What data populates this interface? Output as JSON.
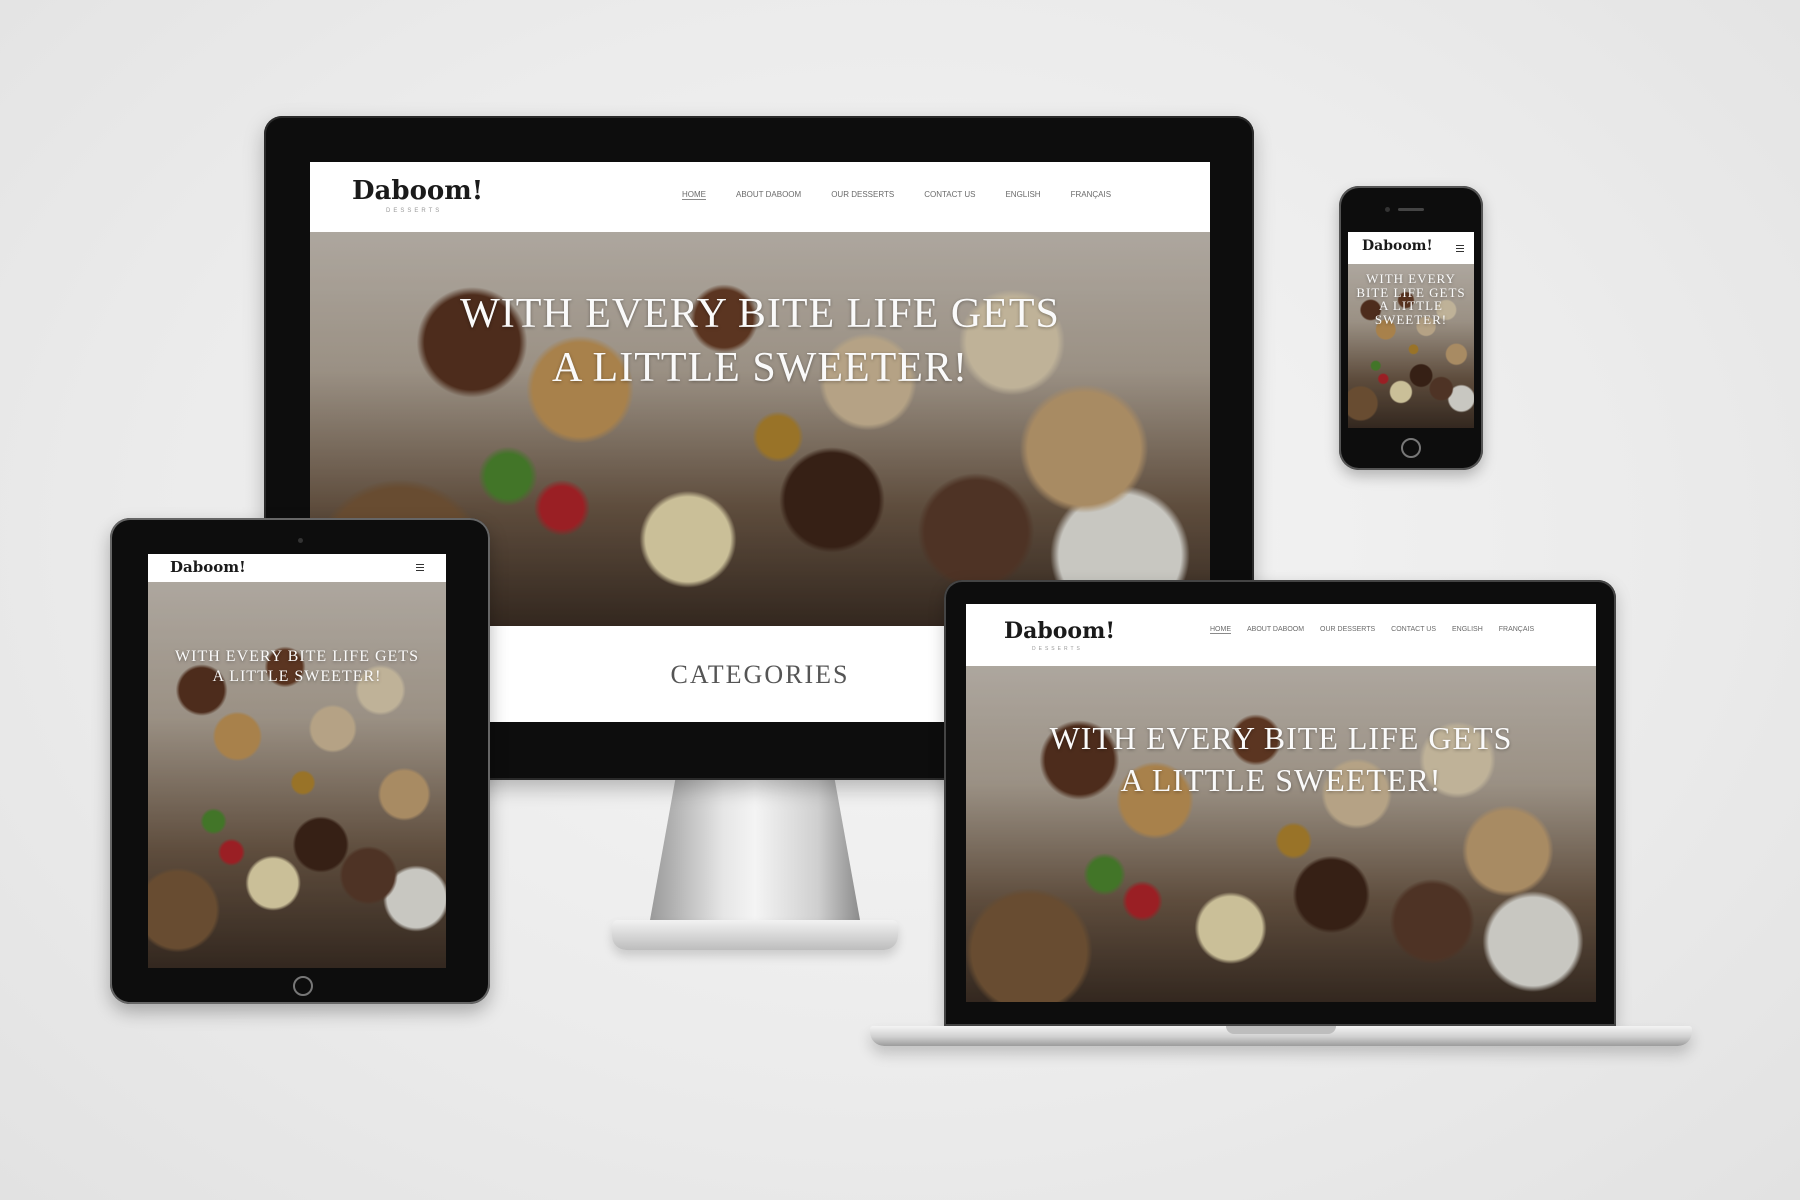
{
  "site": {
    "logo": "Daboom!",
    "logo_sub": "DESSERTS",
    "nav": [
      "HOME",
      "ABOUT DABOOM",
      "OUR DESSERTS",
      "CONTACT US",
      "ENGLISH",
      "FRANÇAIS"
    ],
    "hero_line1": "WITH EVERY BITE LIFE GETS",
    "hero_line2": "A LITTLE SWEETER!",
    "section_heading": "CATEGORIES"
  },
  "icons": {
    "menu": "hamburger-icon",
    "home_button": "home-button-icon",
    "camera": "camera-icon"
  },
  "colors": {
    "bezel": "#0d0d0d",
    "background": "#ebebeb",
    "nav_text": "#6a6a6a",
    "hero_text": "#fafafa"
  }
}
